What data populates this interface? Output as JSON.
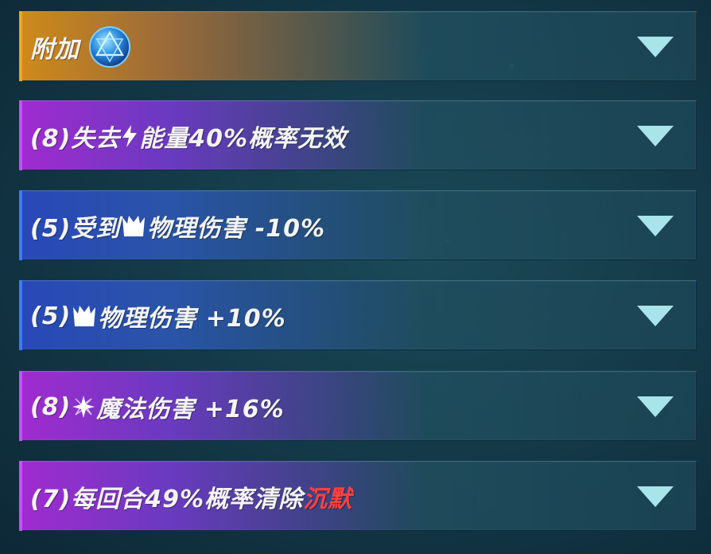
{
  "colors": {
    "accent_red": "#ff4040",
    "arrow": "#a8e4ea",
    "orange": "#c9861c",
    "purple": "#8a2fc4",
    "blue": "#2b53c0"
  },
  "rows": [
    {
      "text": "附加",
      "icon": "blue-crystal-icon",
      "accent": "orange"
    },
    {
      "prefix": "(8)失去",
      "icon": "lightning-icon",
      "suffix": "能量40%概率无效",
      "accent": "purple"
    },
    {
      "prefix": "(5)受到",
      "icon": "physical-damage-icon",
      "suffix": "物理伤害 -10%",
      "accent": "blue"
    },
    {
      "prefix": "(5)",
      "icon": "physical-damage-icon",
      "suffix": "物理伤害 +10%",
      "accent": "blue"
    },
    {
      "prefix": "(8)",
      "icon": "magic-damage-icon",
      "suffix": "魔法伤害 +16%",
      "accent": "purple"
    },
    {
      "prefix": "(7)每回合49%概率清除",
      "highlight": "沉默",
      "accent": "purple"
    }
  ],
  "toggle_icon": "triangle-down-icon"
}
